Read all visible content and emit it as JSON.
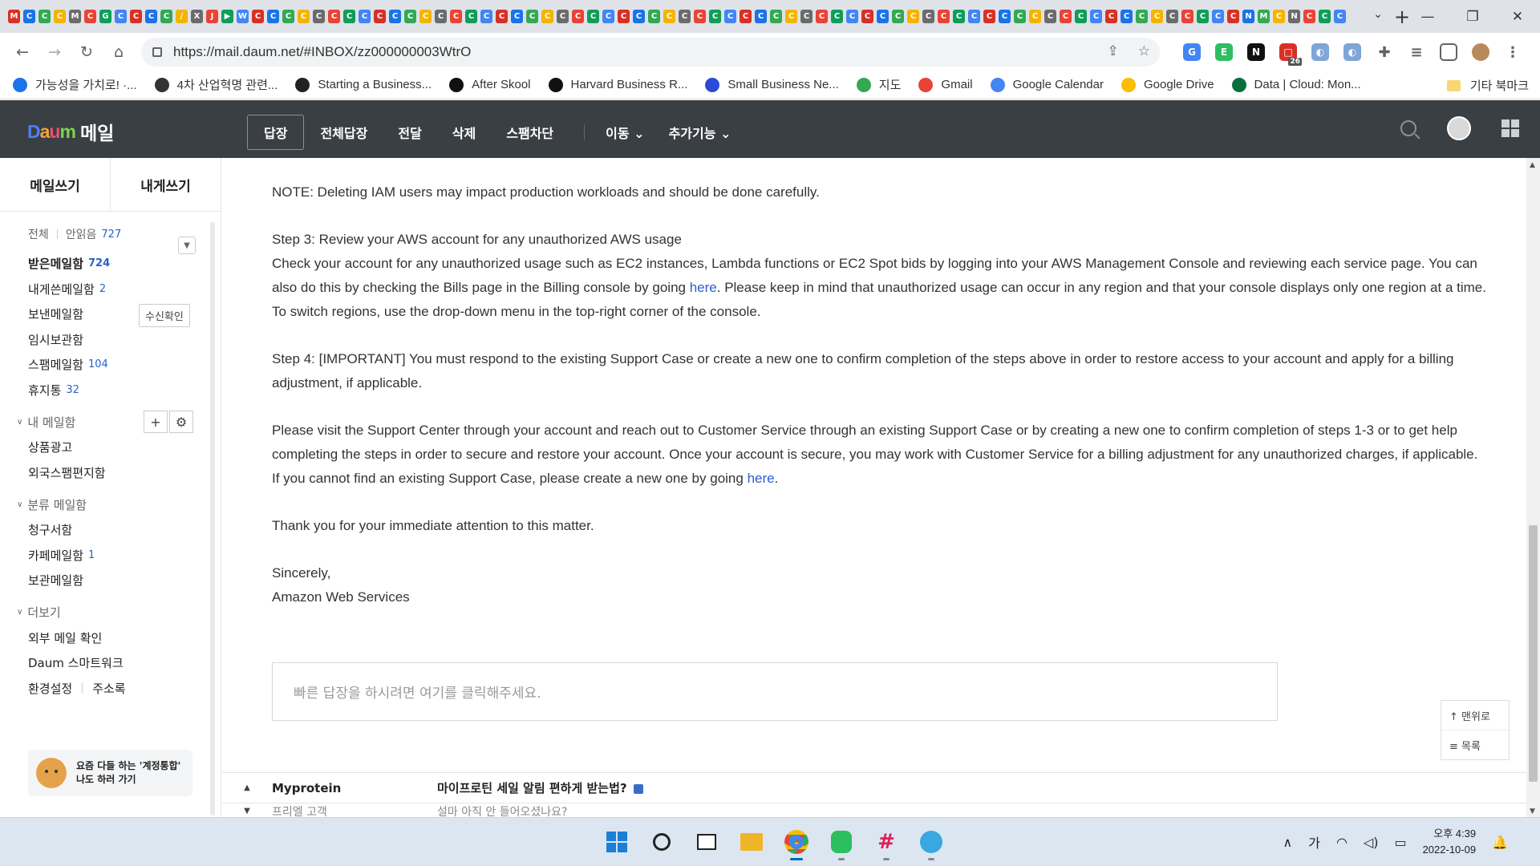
{
  "browser": {
    "tab_icons": [
      "M",
      "C",
      "C",
      "C",
      "M",
      "C",
      "G",
      "C",
      "C",
      "C",
      "C",
      "/",
      "X",
      "J",
      "▶",
      "W",
      "C",
      "C",
      "C",
      "C",
      "C",
      "C",
      "C",
      "C",
      "C",
      "C",
      "C",
      "C",
      "C",
      "C",
      "C",
      "C",
      "C",
      "C",
      "C",
      "C",
      "C",
      "C",
      "C",
      "C",
      "C",
      "C",
      "C",
      "C",
      "C",
      "C",
      "C",
      "C",
      "C",
      "C",
      "C",
      "C",
      "C",
      "C",
      "C",
      "C",
      "C",
      "C",
      "C",
      "C",
      "C",
      "C",
      "C",
      "C",
      "C",
      "C",
      "C",
      "C",
      "C",
      "C",
      "C",
      "C",
      "C",
      "C",
      "C",
      "C",
      "C",
      "C",
      "C",
      "C",
      "C",
      "N",
      "M",
      "C",
      "N",
      "C",
      "C",
      "C"
    ],
    "new_tab": "+",
    "url": "https://mail.daum.net/#INBOX/zz000000003WtrO",
    "extension_badge": "26",
    "window_controls": [
      "—",
      "❐",
      "✕"
    ],
    "bookmarks": [
      {
        "label": "가능성을 가치로! ·...",
        "color": "#1a73e8"
      },
      {
        "label": "4차 산업혁명 관련...",
        "color": "#333333"
      },
      {
        "label": "Starting a Business...",
        "color": "#222222"
      },
      {
        "label": "After Skool",
        "color": "#111111"
      },
      {
        "label": "Harvard Business R...",
        "color": "#111111"
      },
      {
        "label": "Small Business Ne...",
        "color": "#2a4bd7"
      },
      {
        "label": "지도",
        "color": "#34a853"
      },
      {
        "label": "Gmail",
        "color": "#ea4335"
      },
      {
        "label": "Google Calendar",
        "color": "#4285f4"
      },
      {
        "label": "Google Drive",
        "color": "#fbbc04"
      },
      {
        "label": "Data | Cloud: Mon...",
        "color": "#0b6e3e"
      }
    ],
    "other_bookmarks": "기타 북마크"
  },
  "header": {
    "logo_text": "메일",
    "actions": [
      "답장",
      "전체답장",
      "전달",
      "삭제",
      "스팸차단"
    ],
    "dropdowns": [
      "이동",
      "추가기능"
    ]
  },
  "sidebar": {
    "compose": "메일쓰기",
    "self_compose": "내게쓰기",
    "all_label": "전체",
    "unread_label": "안읽음",
    "unread_count": "727",
    "mailboxes": [
      {
        "label": "받은메일함",
        "count": "724"
      },
      {
        "label": "내게쓴메일함",
        "count": "2"
      },
      {
        "label": "보낸메일함",
        "count": ""
      },
      {
        "label": "임시보관함",
        "count": ""
      },
      {
        "label": "스팸메일함",
        "count": "104"
      },
      {
        "label": "휴지통",
        "count": "32"
      }
    ],
    "receipt_check": "수신확인",
    "my_folders_title": "내 메일함",
    "my_folders": [
      {
        "label": "상품광고",
        "count": ""
      },
      {
        "label": "외국스팸편지함",
        "count": ""
      }
    ],
    "category_title": "분류 메일함",
    "categories": [
      {
        "label": "청구서함",
        "count": ""
      },
      {
        "label": "카페메일함",
        "count": "1"
      },
      {
        "label": "보관메일함",
        "count": ""
      }
    ],
    "more_title": "더보기",
    "more_items": [
      "외부 메일 확인",
      "Daum 스마트워크"
    ],
    "settings": "환경설정",
    "address_book": "주소록",
    "promo_line1": "요즘 다들 하는 '계정통합'",
    "promo_line2": "나도 하러 가기"
  },
  "email": {
    "note": "NOTE: Deleting IAM users may impact production workloads and should be done carefully.",
    "step3_title": "Step 3: Review your AWS account for any unauthorized AWS usage",
    "step3_a": "Check your account for any unauthorized usage such as EC2 instances, Lambda functions or EC2 Spot bids by logging into your AWS Management Console and reviewing each service page. You can also do this by checking the Bills page in the Billing console by going ",
    "step3_link": "here",
    "step3_b": ". Please keep in mind that unauthorized usage can occur in any region and that your console displays only one region at a time. To switch regions, use the drop-down menu in the top-right corner of the console.",
    "step4": "Step 4: [IMPORTANT] You must respond to the existing Support Case or create a new one to confirm completion of the steps above in order to restore access to your account and apply for a billing adjustment, if applicable.",
    "support_a": "Please visit the Support Center through your account and reach out to Customer Service through an existing Support Case or by creating a new one to confirm completion of steps 1-3 or to get help completing the steps in order to secure and restore your account. Once your account is secure, you may work with Customer Service for a billing adjustment for any unauthorized charges, if applicable. If you cannot find an existing Support Case, please create a new one by going ",
    "support_link": "here",
    "support_b": ".",
    "thanks": "Thank you for your immediate attention to this matter.",
    "sign_1": "Sincerely,",
    "sign_2": "Amazon Web Services"
  },
  "quick_reply_placeholder": "빠른 답장을 하시려면 여기를 클릭해주세요.",
  "float_nav": {
    "top": "↑ 맨위로",
    "list": "≡ 목록"
  },
  "next_mail": {
    "sender": "Myprotein",
    "subject": "마이프로틴 세일 알림 편하게 받는법?"
  },
  "prev_mail": {
    "sender": "프리엘 고객",
    "subject": "설마 아직 안 들어오셨나요?"
  },
  "taskbar": {
    "ime": "가",
    "time": "오후 4:39",
    "date": "2022-10-09"
  }
}
